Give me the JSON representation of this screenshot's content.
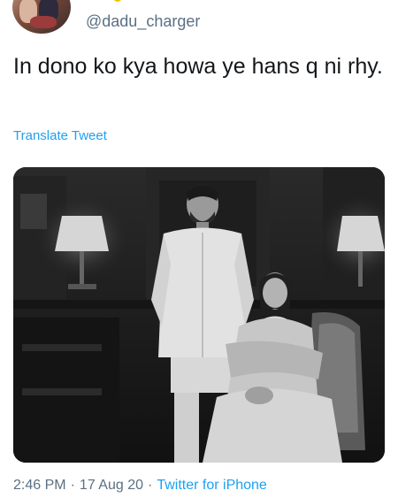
{
  "tweet": {
    "handle": "@dadu_charger",
    "text": "In dono ko kya howa ye hans q ni rhy.",
    "translate_label": "Translate Tweet",
    "time": "2:46 PM",
    "date": "17 Aug 20",
    "source": "Twitter for iPhone",
    "separator": "·"
  },
  "colors": {
    "text": "#14171a",
    "secondary": "#5b7083",
    "link": "#1da1f2"
  }
}
